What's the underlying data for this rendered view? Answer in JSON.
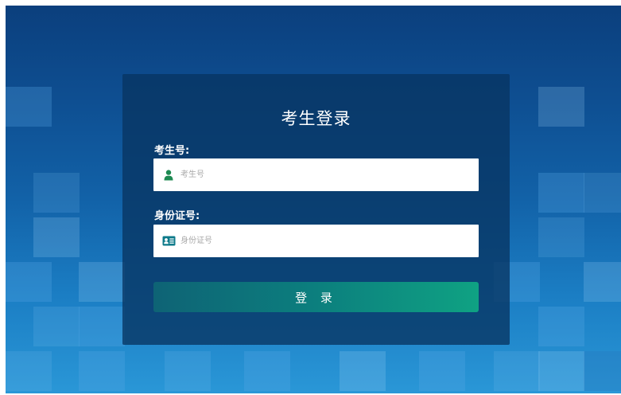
{
  "login": {
    "title": "考生登录",
    "exam_number_label": "考生号:",
    "exam_number_placeholder": "考生号",
    "id_number_label": "身份证号:",
    "id_number_placeholder": "身份证号",
    "submit_label": "登 录"
  },
  "colors": {
    "accent": "#0fa283",
    "icon_green": "#1f8a52",
    "icon_teal": "#0e7a8a"
  },
  "icons": {
    "exam_number": "user-icon",
    "id_number": "id-card-icon"
  }
}
